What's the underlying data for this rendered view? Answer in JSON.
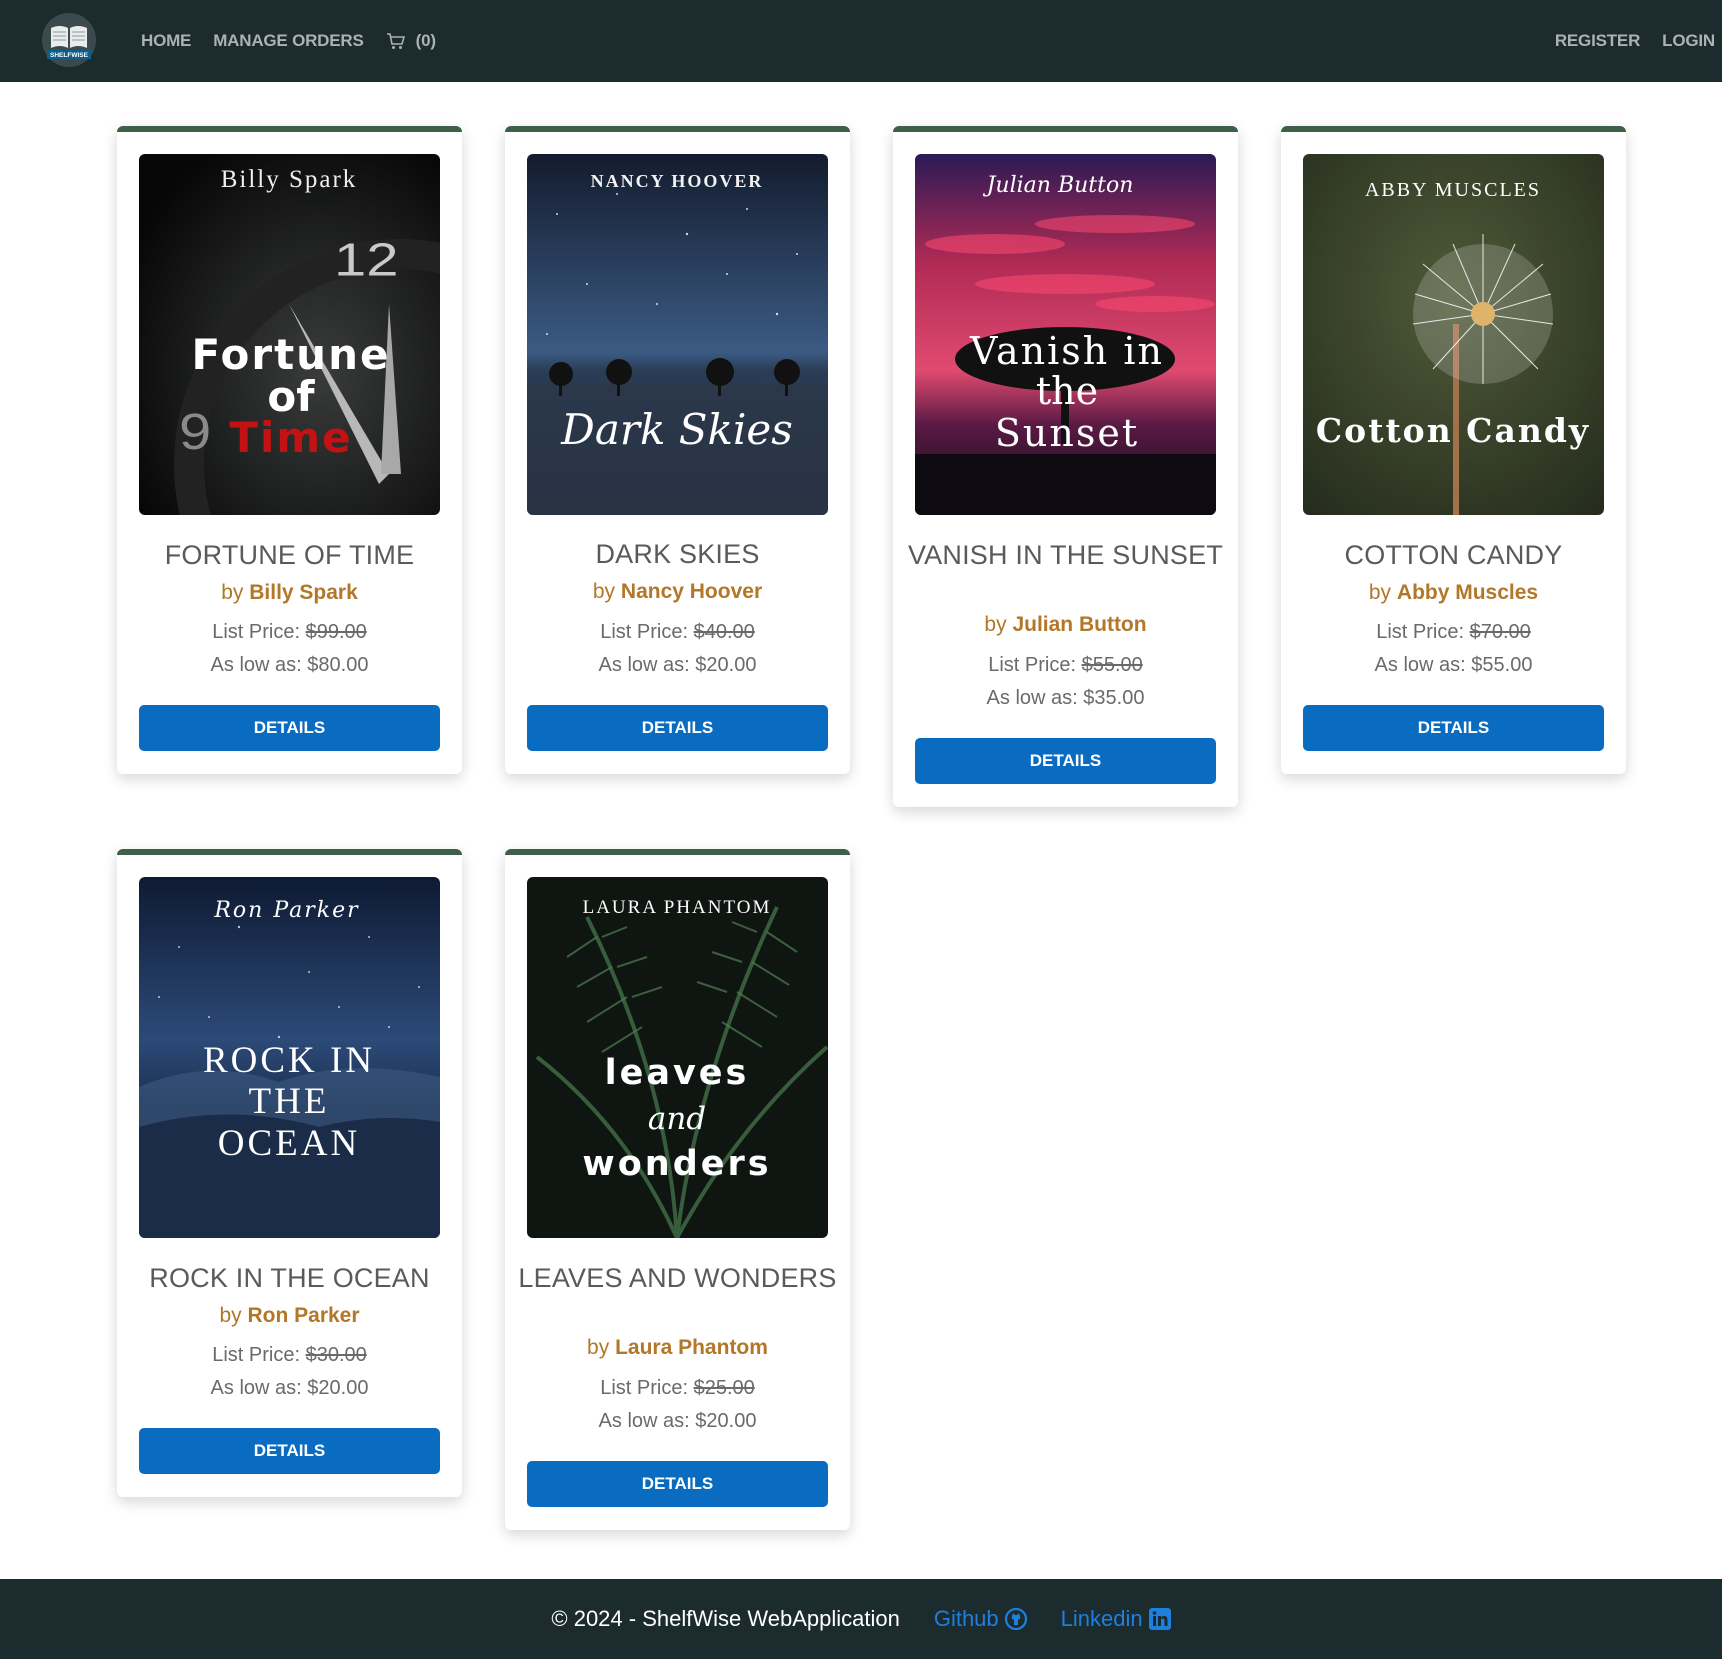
{
  "navbar": {
    "logo_text": "SHELFWISE",
    "home": "HOME",
    "manage_orders": "MANAGE ORDERS",
    "cart_count": "(0)",
    "register": "REGISTER",
    "login": "LOGIN"
  },
  "labels": {
    "by": "by",
    "list_price": "List Price:",
    "as_low_as": "As low as:",
    "details": "DETAILS"
  },
  "products": [
    {
      "title": "FORTUNE OF TIME",
      "author": "Billy Spark",
      "list_price": "$99.00",
      "low_price": "$80.00",
      "cover_author": "Billy Spark",
      "cover_title": [
        "Fortune",
        "of",
        "Time"
      ]
    },
    {
      "title": "DARK SKIES",
      "author": "Nancy Hoover",
      "list_price": "$40.00",
      "low_price": "$20.00",
      "cover_author": "NANCY HOOVER",
      "cover_title": [
        "Dark Skies"
      ]
    },
    {
      "title": "VANISH IN THE SUNSET",
      "author": "Julian Button",
      "list_price": "$55.00",
      "low_price": "$35.00",
      "cover_author": "Julian Button",
      "cover_title": [
        "Vanish in",
        "the",
        "Sunset"
      ]
    },
    {
      "title": "COTTON CANDY",
      "author": "Abby Muscles",
      "list_price": "$70.00",
      "low_price": "$55.00",
      "cover_author": "ABBY MUSCLES",
      "cover_title": [
        "Cotton Candy"
      ]
    },
    {
      "title": "ROCK IN THE OCEAN",
      "author": "Ron Parker",
      "list_price": "$30.00",
      "low_price": "$20.00",
      "cover_author": "Ron Parker",
      "cover_title": [
        "ROCK IN",
        "THE",
        "OCEAN"
      ]
    },
    {
      "title": "LEAVES AND WONDERS",
      "author": "Laura Phantom",
      "list_price": "$25.00",
      "low_price": "$20.00",
      "cover_author": "LAURA PHANTOM",
      "cover_title": [
        "leaves",
        "and",
        "wonders"
      ]
    }
  ],
  "footer": {
    "copyright": "© 2024 - ShelfWise WebApplication",
    "github": "Github",
    "linkedin": "Linkedin"
  },
  "colors": {
    "navbar_bg": "#1c2b2d",
    "card_accent": "#3f6048",
    "author": "#b27728",
    "button": "#0a6cc0",
    "link": "#1f7fdc"
  }
}
